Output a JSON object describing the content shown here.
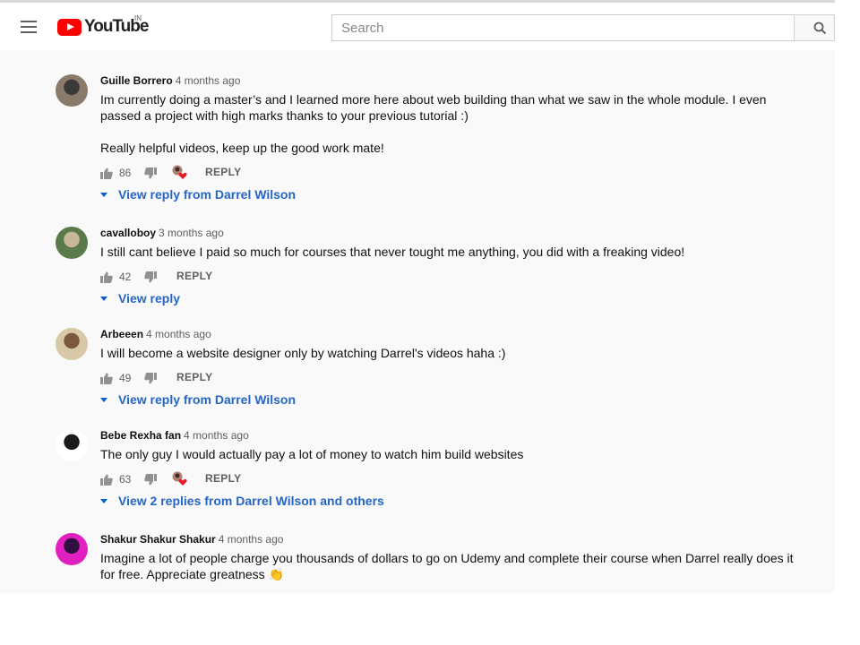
{
  "header": {
    "logo_text": "YouTube",
    "country_code": "IN",
    "search_placeholder": "Search"
  },
  "comments": [
    {
      "author": "Guille Borrero",
      "time": "4 months ago",
      "text_paragraphs": [
        "Im currently doing a master’s and I learned more here about web building than what we saw in the whole module. I even passed a project with high marks thanks to your previous tutorial :)",
        "Really helpful videos, keep up the good work mate!"
      ],
      "likes": "86",
      "creator_heart": true,
      "reply_label": "REPLY",
      "view_replies": "View reply from Darrel Wilson"
    },
    {
      "author": "cavalloboy",
      "time": "3 months ago",
      "text_paragraphs": [
        "I still cant believe I paid so much for courses that never tought me anything, you did with a freaking video!"
      ],
      "likes": "42",
      "creator_heart": false,
      "reply_label": "REPLY",
      "view_replies": "View reply"
    },
    {
      "author": "Arbeeen",
      "time": "4 months ago",
      "text_paragraphs": [
        "I will become a website designer only by watching Darrel's videos haha :)"
      ],
      "likes": "49",
      "creator_heart": false,
      "reply_label": "REPLY",
      "view_replies": "View reply from Darrel Wilson"
    },
    {
      "author": "Bebe Rexha fan",
      "time": "4 months ago",
      "text_paragraphs": [
        "The only guy I would actually pay a lot of money to watch him build websites"
      ],
      "likes": "63",
      "creator_heart": true,
      "reply_label": "REPLY",
      "view_replies": "View 2 replies from Darrel Wilson and others"
    },
    {
      "author": "Shakur Shakur Shakur",
      "time": "4 months ago",
      "text_paragraphs": [
        "Imagine a lot of people charge you thousands of dollars  to go on Udemy and complete their course when Darrel really does it for free. Appreciate greatness 👏"
      ]
    }
  ]
}
